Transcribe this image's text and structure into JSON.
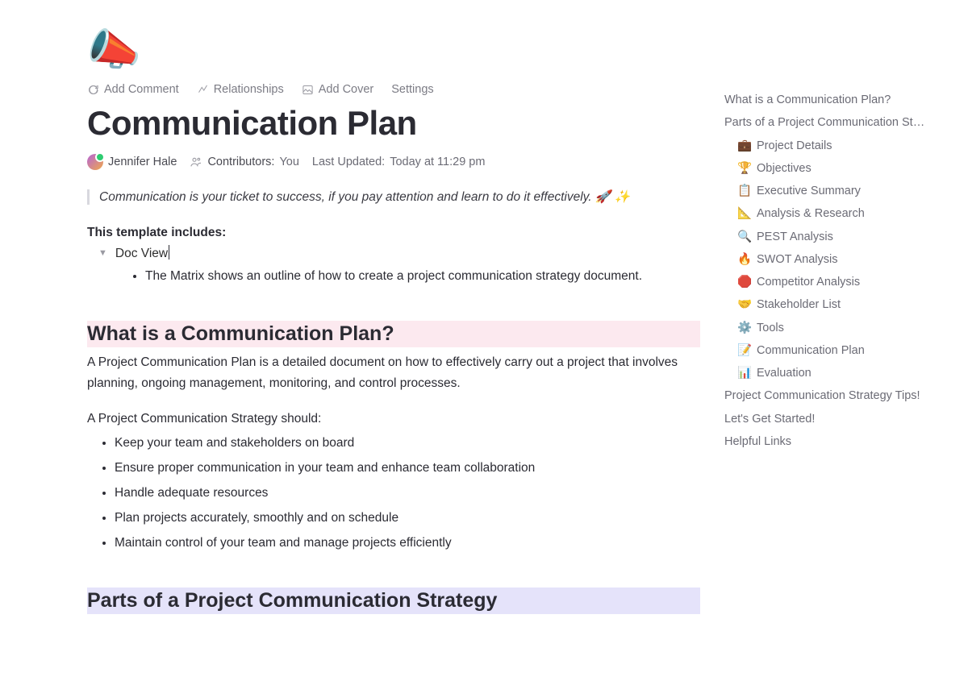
{
  "heroIcon": "📣",
  "toolbar": {
    "comment": "Add Comment",
    "relationships": "Relationships",
    "cover": "Add Cover",
    "settings": "Settings"
  },
  "title": "Communication Plan",
  "author": "Jennifer Hale",
  "contributorsLabel": "Contributors:",
  "contributorsValue": "You",
  "lastUpdatedLabel": "Last Updated:",
  "lastUpdatedValue": "Today at 11:29 pm",
  "quote": "Communication is your ticket to success, if you pay attention and learn to do it effectively. 🚀 ✨",
  "includesLabel": "This template includes:",
  "toggleLabel": "Doc View",
  "matrixText": "The Matrix shows an outline of how to create a project communication strategy document.",
  "heading1": "What is a Communication Plan?",
  "para1": "A Project Communication Plan is a detailed document on how to effectively carry out a project that involves planning, ongoing management, monitoring, and control processes.",
  "para2": "A Project Communication Strategy should:",
  "strategyList": [
    "Keep your team and stakeholders on board",
    "Ensure proper communication in your team and enhance team collaboration",
    "Handle adequate resources",
    "Plan projects accurately, smoothly and on schedule",
    "Maintain control of your team and manage projects efficiently"
  ],
  "heading2": "Parts of a Project Communication Strategy",
  "toc": {
    "top": [
      "What is a Communication Plan?",
      "Parts of a Project Communication St…"
    ],
    "sub": [
      {
        "emoji": "💼",
        "label": "Project Details"
      },
      {
        "emoji": "🏆",
        "label": "Objectives"
      },
      {
        "emoji": "📋",
        "label": "Executive Summary"
      },
      {
        "emoji": "📐",
        "label": "Analysis & Research"
      },
      {
        "emoji": "🔍",
        "label": "PEST Analysis"
      },
      {
        "emoji": "🔥",
        "label": "SWOT Analysis"
      },
      {
        "emoji": "🛑",
        "label": "Competitor Analysis"
      },
      {
        "emoji": "🤝",
        "label": "Stakeholder List"
      },
      {
        "emoji": "⚙️",
        "label": "Tools"
      },
      {
        "emoji": "📝",
        "label": "Communication Plan"
      },
      {
        "emoji": "📊",
        "label": "Evaluation"
      }
    ],
    "bottom": [
      "Project Communication Strategy Tips!",
      "Let's Get Started!",
      "Helpful Links"
    ]
  }
}
